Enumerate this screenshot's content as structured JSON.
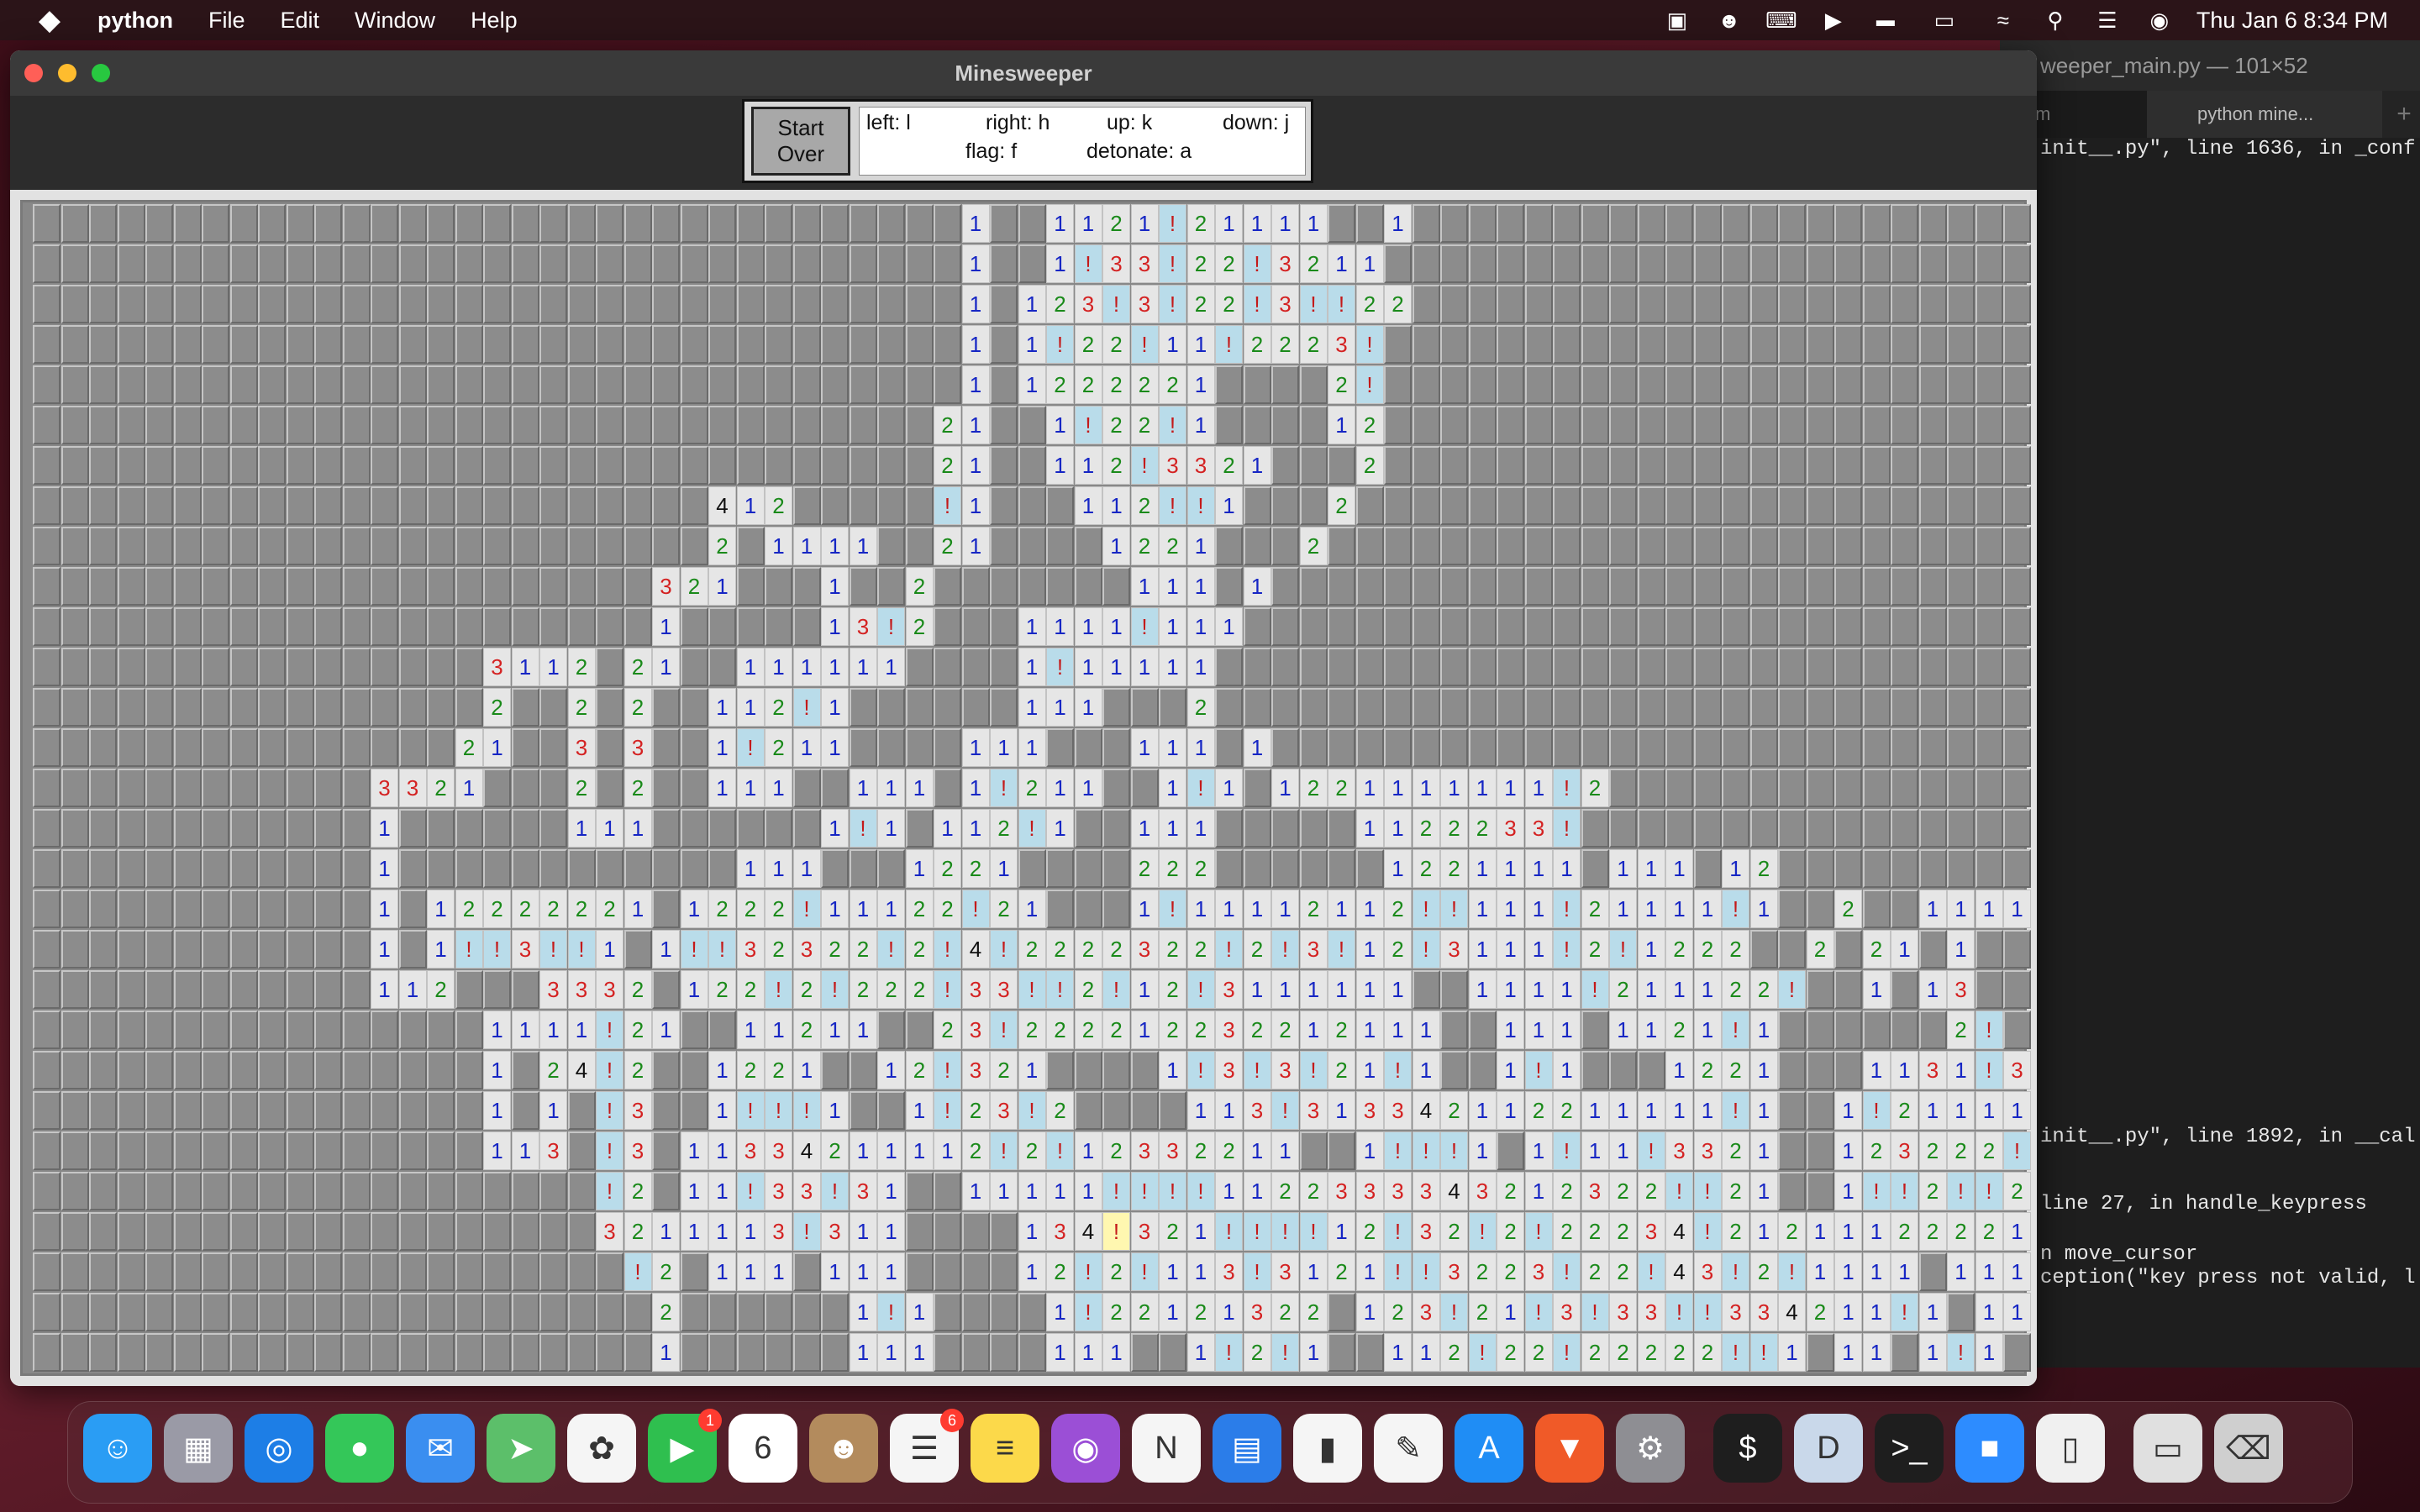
{
  "menubar": {
    "app_name": "python",
    "items": [
      "File",
      "Edit",
      "Window",
      "Help"
    ],
    "clock": "Thu Jan 6  8:34 PM",
    "status_icons": [
      "screen-record-icon",
      "accessibility-icon",
      "keyboard-icon",
      "play-icon",
      "flag-icon",
      "battery-icon",
      "wifi-icon",
      "search-icon",
      "control-center-icon",
      "siri-icon"
    ]
  },
  "window": {
    "title": "Minesweeper",
    "start_label_1": "Start",
    "start_label_2": "Over",
    "help": {
      "left": "left: l",
      "right": "right: h",
      "up": "up: k",
      "down": "down: j",
      "flag": "flag: f",
      "detonate": "detonate: a"
    }
  },
  "terminal": {
    "title": "weeper_main.py — 101×52",
    "tab_a": "m",
    "tab_b": "python mine...",
    "plus": "+",
    "lines": [
      "init__.py\", line 1636, in _conf",
      "init__.py\", line 1892, in __cal",
      "line 27, in handle_keypress",
      "n move_cursor",
      "ception(\"key press not valid, l"
    ]
  },
  "board": {
    "cols": 71,
    "rows": 29,
    "cursor": [
      25,
      38
    ],
    "grid": [
      "#################################1##1121!21111##1######################",
      "#################################1##1!33!22!3211######################",
      "#################################1#123!3!22!3!!22######################",
      "#################################1#1!22!11!2223!######################",
      "#################################1#1222221####2!######################",
      "################################21##1!22!1####12######################",
      "################################21##112!3321###2######################",
      "########################412#####!1###112!!1###2######################",
      "########################2#1111##21####1221###2######################",
      "######################321###1##2#######111#1######################",
      "######################1#####13!2###1111!111######################",
      "################3112#21##111111####1!11111######################",
      "################2##2#2##112!1######111###2######################",
      "###############21##3#3##1!211####111###111#1######################",
      "############3321###2#2##111##111#1!211##1!1#1221111111!2############",
      "############1######111######1!1#112!1##111#####1122233!############",
      "############1############111###1221####222######1221111#111#12############",
      "############1#12222221#1222!11122!21###1!11112112!!111!21111!1##2##1111####",
      "############1#1!!3!!1#1!!32322!2!4!2222322!2!3!12!3111!2!1222##2#21#1####",
      "############112###3332#122!2!222!33!!2!12!3111111##1111!211122!##1#13##",
      "################1111!21##11211##23!222212232212111##111#1121!1######2!##22",
      "################1#24!2##1221##12!321####1!3!3!21!1##1!1###1221###1131!32!1",
      "################1#1#!3##1!!!1##1!23!2####113!313342112211111!1##1!211111",
      "################113#!3#11334211112!2!12332211##1!!!1#1!11!3321##123222!1",
      "####################!2#11!33!31##11111!!!!1122333343212322!!21##1!!2!!21",
      "####################3211113!311####134!321!!!!12!32!2!22234!21211122221!1",
      "#####################!2#111#111####12!2!113!3121!!3223!22!43!2!1111#111",
      "######################2######1!1####1!22121322#123!21!3!33!!334211!1#11",
      "######################1######111####111##1!2!1##112!22!22222!!1#11#1!1"
    ]
  },
  "dock": {
    "icons": [
      {
        "name": "finder-icon",
        "color": "#2a9df4",
        "glyph": "☺"
      },
      {
        "name": "launchpad-icon",
        "color": "#9a9aa6",
        "glyph": "▦"
      },
      {
        "name": "safari-icon",
        "color": "#1d7ee6",
        "glyph": "◎"
      },
      {
        "name": "messages-icon",
        "color": "#34c759",
        "glyph": "●"
      },
      {
        "name": "mail-icon",
        "color": "#3a8ef0",
        "glyph": "✉"
      },
      {
        "name": "maps-icon",
        "color": "#5cbf6a",
        "glyph": "➤"
      },
      {
        "name": "photos-icon",
        "color": "#f5f5f5",
        "glyph": "✿"
      },
      {
        "name": "facetime-icon",
        "color": "#2fbf4f",
        "glyph": "▶",
        "badge": "1"
      },
      {
        "name": "calendar-icon",
        "color": "#ffffff",
        "glyph": "6"
      },
      {
        "name": "contacts-icon",
        "color": "#b38b5d",
        "glyph": "☻"
      },
      {
        "name": "reminders-icon",
        "color": "#f5f5f5",
        "glyph": "☰",
        "badge": "6"
      },
      {
        "name": "notes-icon",
        "color": "#fcd94a",
        "glyph": "≡"
      },
      {
        "name": "podcasts-icon",
        "color": "#9b4fd6",
        "glyph": "◉"
      },
      {
        "name": "news-icon",
        "color": "#f5f5f5",
        "glyph": "N"
      },
      {
        "name": "keynote-icon",
        "color": "#2b7de9",
        "glyph": "▤"
      },
      {
        "name": "numbers-icon",
        "color": "#f5f5f5",
        "glyph": "▮"
      },
      {
        "name": "pages-icon",
        "color": "#f5f5f5",
        "glyph": "✎"
      },
      {
        "name": "app-store-icon",
        "color": "#1f8df5",
        "glyph": "A"
      },
      {
        "name": "brave-icon",
        "color": "#f05a28",
        "glyph": "▼"
      },
      {
        "name": "system-preferences-icon",
        "color": "#8e8e93",
        "glyph": "⚙"
      },
      {
        "name": "terminal-icon",
        "color": "#1e1e1e",
        "glyph": "$"
      },
      {
        "name": "djvu-icon",
        "color": "#c9d8ea",
        "glyph": "D"
      },
      {
        "name": "terminal-2-icon",
        "color": "#1e1e1e",
        "glyph": ">_"
      },
      {
        "name": "zoom-icon",
        "color": "#2d8cff",
        "glyph": "■"
      },
      {
        "name": "document-icon",
        "color": "#f0f0f0",
        "glyph": "▯"
      },
      {
        "name": "downloads-icon",
        "color": "#e0e0e0",
        "glyph": "▭"
      },
      {
        "name": "trash-icon",
        "color": "#cfcfcf",
        "glyph": "⌫"
      }
    ]
  }
}
